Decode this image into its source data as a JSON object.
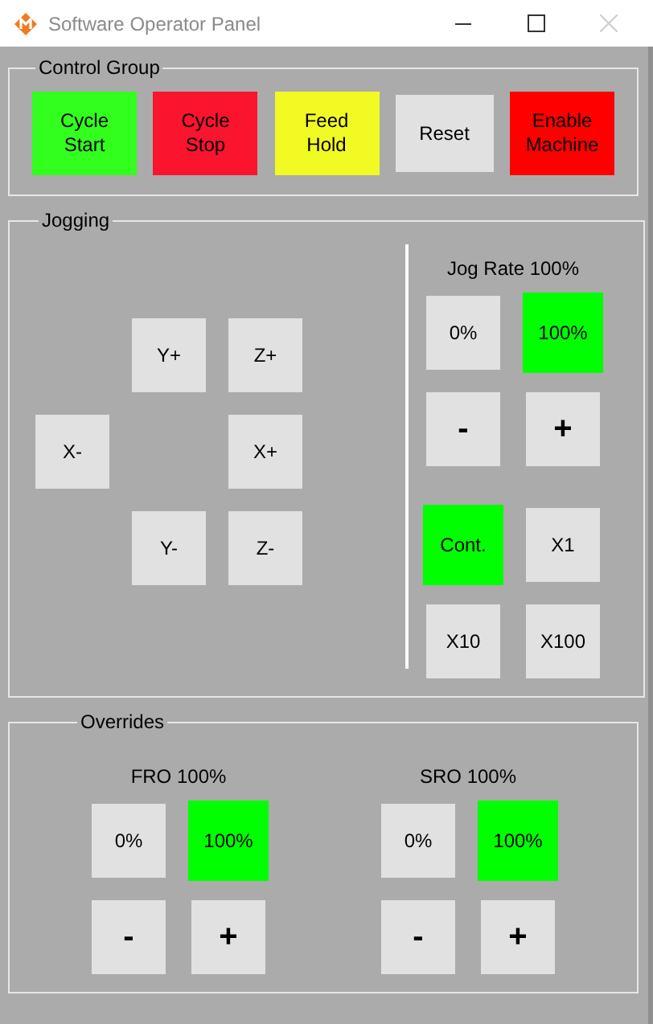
{
  "window": {
    "title": "Software Operator Panel"
  },
  "control_group": {
    "title": "Control Group",
    "buttons": [
      {
        "label": "Cycle\nStart",
        "color": "#33ff1f"
      },
      {
        "label": "Cycle\nStop",
        "color": "#fa142e"
      },
      {
        "label": "Feed\nHold",
        "color": "#f2fa24"
      },
      {
        "label": "Reset",
        "color": "#e1e1e1"
      },
      {
        "label": "Enable\nMachine",
        "color": "#ff0000"
      }
    ]
  },
  "jogging": {
    "title": "Jogging",
    "jog_buttons": [
      {
        "label": "Y+"
      },
      {
        "label": "Z+"
      },
      {
        "label": "X-"
      },
      {
        "label": "X+"
      },
      {
        "label": "Y-"
      },
      {
        "label": "Z-"
      }
    ],
    "jog_rate": {
      "label": "Jog Rate 100%",
      "presets": [
        {
          "label": "0%",
          "selected": false
        },
        {
          "label": "100%",
          "selected": true
        }
      ],
      "steps": [
        "-",
        "+"
      ]
    },
    "increments": [
      {
        "label": "Cont.",
        "selected": true
      },
      {
        "label": "X1",
        "selected": false
      },
      {
        "label": "X10",
        "selected": false
      },
      {
        "label": "X100",
        "selected": false
      }
    ]
  },
  "overrides": {
    "title": "Overrides",
    "groups": [
      {
        "label": "FRO 100%",
        "presets": [
          {
            "label": "0%",
            "selected": false
          },
          {
            "label": "100%",
            "selected": true
          }
        ],
        "steps": [
          "-",
          "+"
        ]
      },
      {
        "label": "SRO 100%",
        "presets": [
          {
            "label": "0%",
            "selected": false
          },
          {
            "label": "100%",
            "selected": true
          }
        ],
        "steps": [
          "-",
          "+"
        ]
      }
    ]
  }
}
